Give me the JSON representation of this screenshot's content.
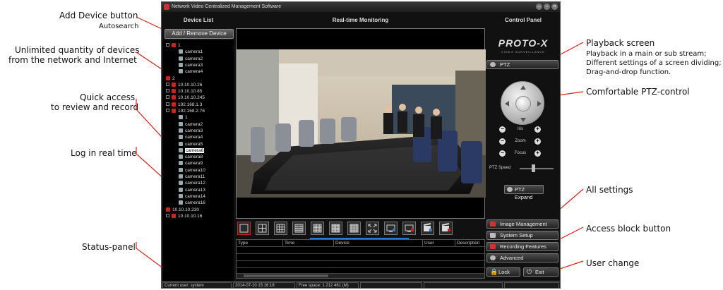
{
  "app": {
    "window_title": "Network Video Centralized Management Software",
    "panels": {
      "device_list": "Device List",
      "monitoring": "Real-time Monitoring",
      "control_panel": "Control Panel"
    }
  },
  "device_list": {
    "add_remove_label": "Add / Remove Device",
    "tree": [
      {
        "label": "1",
        "type": "group",
        "level": 0,
        "expandable": true
      },
      {
        "label": "camera1",
        "type": "camera",
        "level": 1
      },
      {
        "label": "camera2",
        "type": "camera",
        "level": 1
      },
      {
        "label": "camera3",
        "type": "camera",
        "level": 1
      },
      {
        "label": "camera4",
        "type": "camera",
        "level": 1
      },
      {
        "label": "2",
        "type": "group",
        "level": 0
      },
      {
        "label": "10.10.10.26",
        "type": "group",
        "level": 0,
        "expandable": true
      },
      {
        "label": "10.10.10.85",
        "type": "group",
        "level": 0,
        "expandable": true
      },
      {
        "label": "10.10.10.245",
        "type": "group",
        "level": 0,
        "expandable": true
      },
      {
        "label": "192.168.1.3",
        "type": "group",
        "level": 0,
        "expandable": true
      },
      {
        "label": "192.168.2.76",
        "type": "group",
        "level": 0,
        "expandable": true
      },
      {
        "label": "1",
        "type": "camera",
        "level": 1
      },
      {
        "label": "camera2",
        "type": "camera",
        "level": 1
      },
      {
        "label": "camera3",
        "type": "camera",
        "level": 1
      },
      {
        "label": "camera4",
        "type": "camera",
        "level": 1
      },
      {
        "label": "camera5",
        "type": "camera",
        "level": 1
      },
      {
        "label": "camera6",
        "type": "camera",
        "level": 1,
        "selected": true
      },
      {
        "label": "camera8",
        "type": "camera",
        "level": 1
      },
      {
        "label": "camera9",
        "type": "camera",
        "level": 1
      },
      {
        "label": "camera10",
        "type": "camera",
        "level": 1
      },
      {
        "label": "camera11",
        "type": "camera",
        "level": 1
      },
      {
        "label": "camera12",
        "type": "camera",
        "level": 1
      },
      {
        "label": "camera13",
        "type": "camera",
        "level": 1
      },
      {
        "label": "camera14",
        "type": "camera",
        "level": 1
      },
      {
        "label": "camera16",
        "type": "camera",
        "level": 1
      },
      {
        "label": "10.10.10.230",
        "type": "group",
        "level": 0
      },
      {
        "label": "10.10.10.16",
        "type": "group",
        "level": 0,
        "expandable": true
      }
    ]
  },
  "log": {
    "columns": [
      "Type",
      "Time",
      "Device",
      "User",
      "Description"
    ]
  },
  "control_panel": {
    "brand": "PROTO-X",
    "brand_sub": "VIDEO SURVEILLANCE",
    "ptz_label": "PTZ",
    "iris_label": "Iris",
    "zoom_label": "Zoom",
    "focus_label": "Focus",
    "ptz_speed_label": "PTZ Speed",
    "ptz_expand_label": "PTZ Expand",
    "image_management": "Image Management",
    "system_setup": "System Setup",
    "recording_features": "Recording Features",
    "advanced": "Advanced",
    "lock": "Lock",
    "exit": "Exit"
  },
  "status_bar": {
    "current_user": "Current user: system",
    "datetime": "2014-07-10 15:16:18",
    "free_space": "Free space: 1 212 461 (M)"
  },
  "annotations": {
    "add_device": {
      "title": "Add Device button",
      "sub": "Autosearch"
    },
    "unlimited": {
      "line1": "Unlimited quantity of devices",
      "line2": "from the network and Internet"
    },
    "quick_access": {
      "line1": "Quick access",
      "line2": "to review and record"
    },
    "log": {
      "title": "Log in real time"
    },
    "status": {
      "title": "Status-panel"
    },
    "playback": {
      "title": "Playback screen",
      "sub1": "Playback in a main or sub stream;",
      "sub2": "Different settings of a screen dividing;",
      "sub3": "Drag-and-drop function."
    },
    "ptz": {
      "title": "Comfortable PTZ-control"
    },
    "settings": {
      "title": "All settings"
    },
    "lock": {
      "title": "Access block button"
    },
    "user": {
      "title": "User change"
    }
  },
  "colors": {
    "window_bg": "#111111",
    "accent_line": "#d42020",
    "selection": "#ffffff"
  }
}
